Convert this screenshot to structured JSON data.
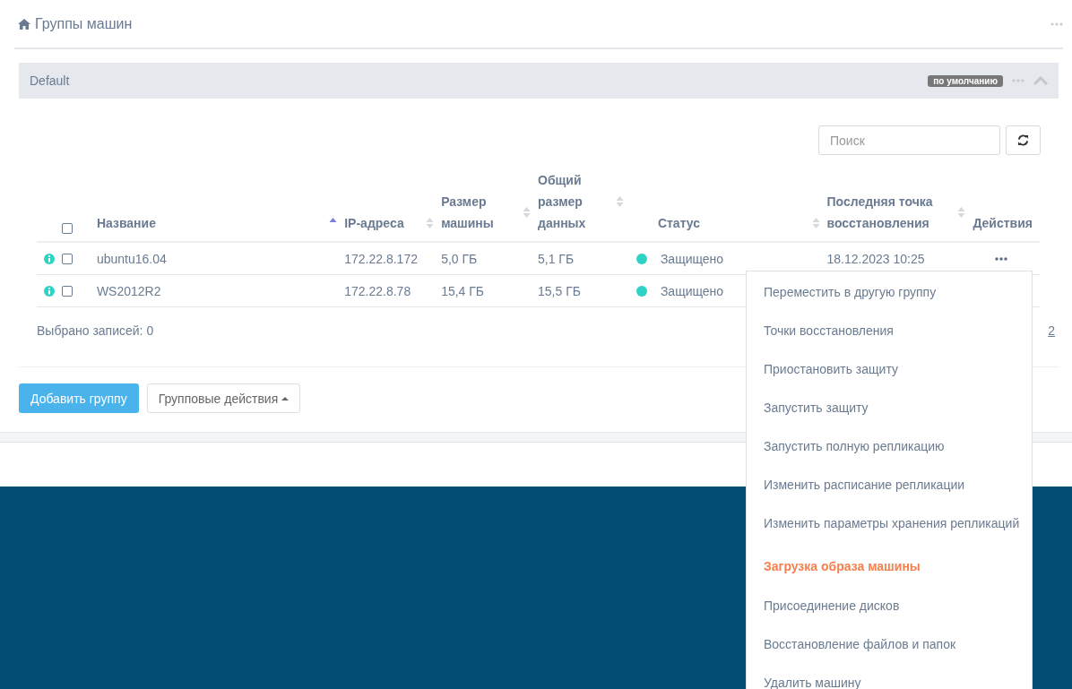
{
  "breadcrumb": {
    "title": "Группы машин"
  },
  "group": {
    "name": "Default",
    "badge": "по умолчанию",
    "expanded": true
  },
  "search": {
    "placeholder": "Поиск"
  },
  "table": {
    "all_checked": false,
    "columns": [
      {
        "label": "Название",
        "sortable": true,
        "sorted": true
      },
      {
        "label": "IP-адреса",
        "sortable": true,
        "sorted": false
      },
      {
        "label": "Размер машины",
        "sortable": true,
        "sorted": false
      },
      {
        "label": "Общий размер данных",
        "sortable": true,
        "sorted": false
      },
      {
        "label": "Статус",
        "sortable": true,
        "sorted": false
      },
      {
        "label": "Последняя точка восстановления",
        "sortable": true,
        "sorted": false
      },
      {
        "label": "Действия",
        "sortable": false
      }
    ],
    "rows": [
      {
        "checked": false,
        "name": "ubuntu16.04",
        "ip": "172.22.8.172",
        "size": "5,0 ГБ",
        "data": "5,1 ГБ",
        "color": "#2ed3c6",
        "status": "Защищено",
        "last": "18.12.2023 10:25",
        "menu_open": true
      },
      {
        "checked": false,
        "name": "WS2012R2",
        "ip": "172.22.8.78",
        "size": "15,4 ГБ",
        "data": "15,5 ГБ",
        "color": "#2ed3c6",
        "status": "Защищено",
        "menu_open": false
      }
    ]
  },
  "selected_count": "Выбрано записей: 0",
  "pagination": "2",
  "buttons": {
    "add": "Добавить группу",
    "group_actions": "Групповые действия"
  },
  "menu": [
    {
      "label": "Переместить в другую группу",
      "selected": false
    },
    {
      "label": "Точки восстановления",
      "selected": false
    },
    {
      "label": "Приостановить защиту",
      "selected": false
    },
    {
      "label": "Запустить защиту",
      "selected": false
    },
    {
      "label": "Запустить полную репликацию",
      "selected": false
    },
    {
      "label": "Изменить расписание репликации",
      "selected": false
    },
    {
      "label": "Изменить параметры хранения репликаций",
      "selected": false
    },
    {
      "label": "Загрузка образа машины",
      "selected": true
    },
    {
      "label": "Присоединение дисков",
      "selected": false
    },
    {
      "label": "Восстановление файлов и папок",
      "selected": false
    },
    {
      "label": "Удалить машину",
      "selected": false
    }
  ]
}
